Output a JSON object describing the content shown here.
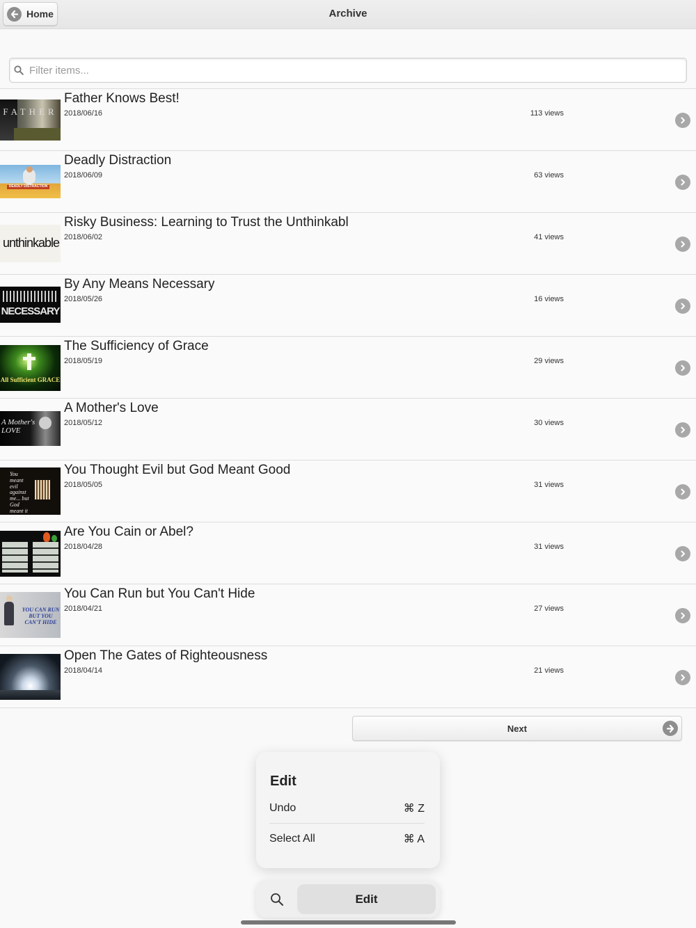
{
  "header": {
    "title": "Archive",
    "home_label": "Home"
  },
  "filter": {
    "placeholder": "Filter items..."
  },
  "items": [
    {
      "title": "Father Knows Best!",
      "date": "2018/06/16",
      "views": "113 views"
    },
    {
      "title": "Deadly Distraction",
      "date": "2018/06/09",
      "views": "63 views"
    },
    {
      "title": "Risky Business: Learning to Trust the Unthinkabl",
      "date": "2018/06/02",
      "views": "41 views"
    },
    {
      "title": "By Any Means Necessary",
      "date": "2018/05/26",
      "views": "16 views"
    },
    {
      "title": "The Sufficiency of Grace",
      "date": "2018/05/19",
      "views": "29 views"
    },
    {
      "title": "A Mother's Love",
      "date": "2018/05/12",
      "views": "30 views"
    },
    {
      "title": "You Thought Evil but God Meant Good",
      "date": "2018/05/05",
      "views": "31 views"
    },
    {
      "title": "Are You Cain or Abel?",
      "date": "2018/04/28",
      "views": "31 views"
    },
    {
      "title": "You Can Run but You Can't Hide",
      "date": "2018/04/21",
      "views": "27 views"
    },
    {
      "title": "Open The Gates of Righteousness",
      "date": "2018/04/14",
      "views": "21 views"
    }
  ],
  "thumbnails": {
    "father": "FATHER",
    "deadly": "DEADLY DISTRACTION",
    "unthinkable": "unthinkable",
    "necessary": "NECESSARY",
    "grace": "All Sufficient GRACE",
    "mother": "A Mother's LOVE",
    "evil": "You meant evil against me... but God meant it for good.",
    "run": "YOU CAN RUN BUT YOU CAN'T HIDE"
  },
  "pagination": {
    "next_label": "Next"
  },
  "edit_menu": {
    "title": "Edit",
    "undo_label": "Undo",
    "undo_shortcut": "⌘ Z",
    "select_all_label": "Select All",
    "select_all_shortcut": "⌘ A"
  },
  "bottom_bar": {
    "edit_label": "Edit"
  },
  "colors": {
    "header_bg": "#e9e9e9",
    "chevron": "#a8a8a8",
    "row_bg": "#fafafa",
    "divider": "#dcdcdc"
  }
}
